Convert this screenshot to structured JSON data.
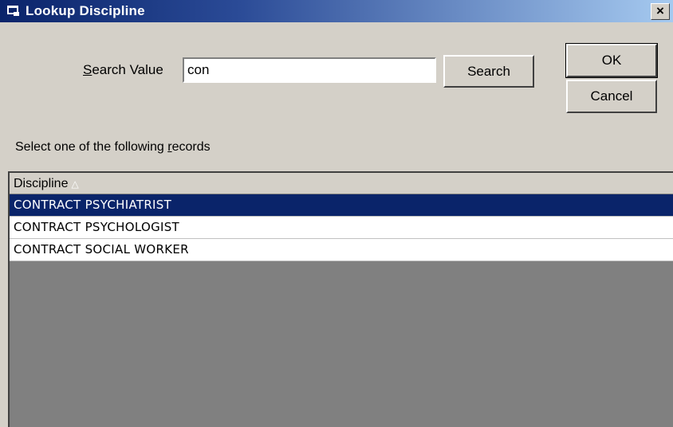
{
  "window": {
    "title": "Lookup Discipline",
    "close_label": "×"
  },
  "search": {
    "label_prefix": "S",
    "label_rest": "earch Value",
    "value": "con",
    "button_label": "Search"
  },
  "actions": {
    "ok_label": "OK",
    "cancel_label": "Cancel"
  },
  "instructions": {
    "prefix": "Select one of the following ",
    "underlined": "r",
    "suffix": "ecords"
  },
  "grid": {
    "column_header": "Discipline",
    "sort_indicator": "△",
    "rows": [
      "CONTRACT PSYCHIATRIST",
      "CONTRACT PSYCHOLOGIST",
      "CONTRACT SOCIAL WORKER"
    ],
    "selected_row": 0
  },
  "colors": {
    "title_bar": "#0a246a",
    "selection": "#0a246a",
    "face": "#d4d0c8",
    "empty_area": "#808080"
  }
}
